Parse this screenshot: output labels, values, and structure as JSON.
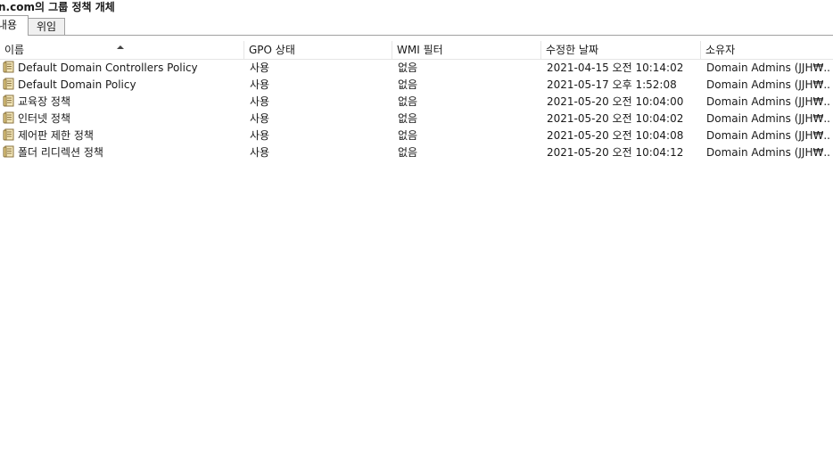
{
  "window": {
    "title": "n.com의 그룹 정책 개체"
  },
  "tabs": [
    {
      "label": "내용",
      "active": true
    },
    {
      "label": "위임",
      "active": false
    }
  ],
  "table": {
    "columns": [
      "이름",
      "GPO 상태",
      "WMI 필터",
      "수정한 날짜",
      "소유자"
    ],
    "sort_column": "이름",
    "sort_direction": "ascending",
    "rows": [
      {
        "name": "Default Domain Controllers Policy",
        "status": "사용",
        "wmi": "없음",
        "modified": "2021-04-15 오전 10:14:02",
        "owner": "Domain Admins (JJH₩..."
      },
      {
        "name": "Default Domain Policy",
        "status": "사용",
        "wmi": "없음",
        "modified": "2021-05-17 오후 1:52:08",
        "owner": "Domain Admins (JJH₩..."
      },
      {
        "name": "교육장 정책",
        "status": "사용",
        "wmi": "없음",
        "modified": "2021-05-20 오전 10:04:00",
        "owner": "Domain Admins (JJH₩..."
      },
      {
        "name": "인터넷 정책",
        "status": "사용",
        "wmi": "없음",
        "modified": "2021-05-20 오전 10:04:02",
        "owner": "Domain Admins (JJH₩..."
      },
      {
        "name": "제어판 제한 정책",
        "status": "사용",
        "wmi": "없음",
        "modified": "2021-05-20 오전 10:04:08",
        "owner": "Domain Admins (JJH₩..."
      },
      {
        "name": "폴더 리디렉션 정책",
        "status": "사용",
        "wmi": "없음",
        "modified": "2021-05-20 오전 10:04:12",
        "owner": "Domain Admins (JJH₩..."
      }
    ]
  },
  "icons": {
    "row_icon": "gpo-scroll-icon",
    "sort_icon": "sort-ascending-icon"
  }
}
